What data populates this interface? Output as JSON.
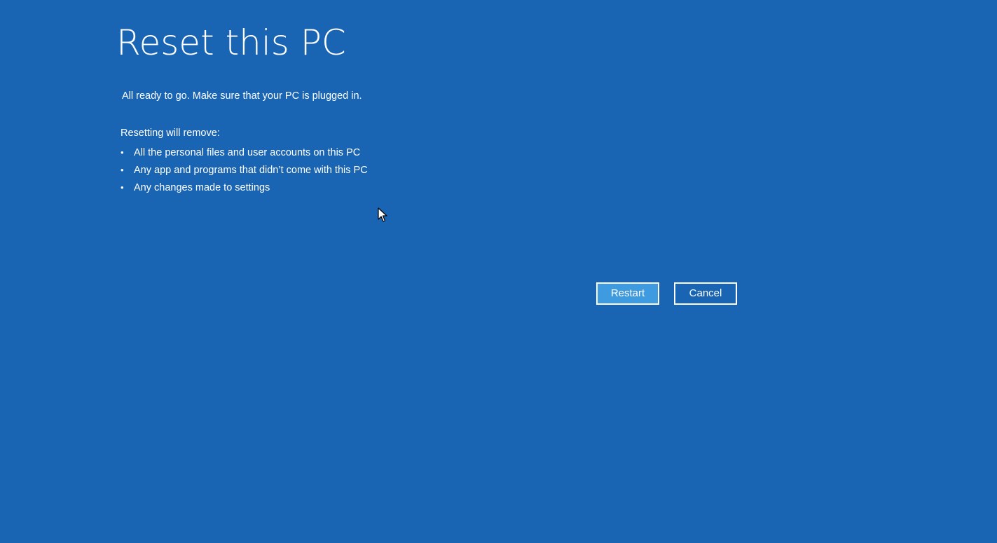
{
  "page": {
    "title": "Reset this PC",
    "ready_message": "All ready to go. Make sure that your PC is plugged in.",
    "remove_heading": "Resetting will remove:",
    "remove_items": [
      "All the personal files and user accounts on this PC",
      "Any app and programs that didn’t come with this PC",
      "Any changes made to settings"
    ],
    "bullet": "•"
  },
  "buttons": {
    "restart_label": "Restart",
    "cancel_label": "Cancel"
  },
  "colors": {
    "background": "#1a65b3",
    "primary_button": "#3f9be0",
    "text": "#ffffff"
  },
  "icons": {
    "cursor": "mouse-pointer-icon"
  }
}
